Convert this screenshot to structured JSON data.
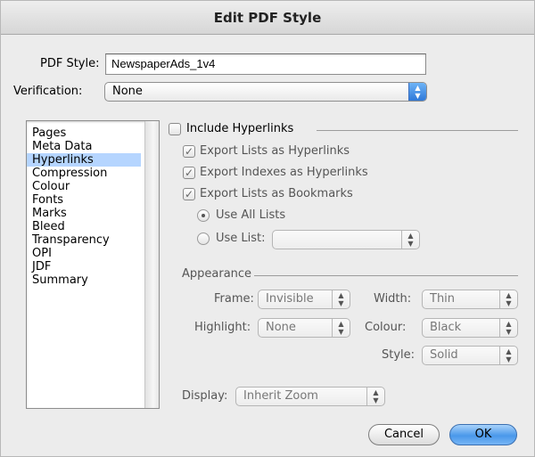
{
  "window": {
    "title": "Edit PDF Style"
  },
  "pdf_style": {
    "label": "PDF Style:",
    "value": "NewspaperAds_1v4"
  },
  "verification": {
    "label": "Verification:",
    "value": "None"
  },
  "sidebar": {
    "items": [
      {
        "label": "Pages"
      },
      {
        "label": "Meta Data"
      },
      {
        "label": "Hyperlinks",
        "selected": true
      },
      {
        "label": "Compression"
      },
      {
        "label": "Colour"
      },
      {
        "label": "Fonts"
      },
      {
        "label": "Marks"
      },
      {
        "label": "Bleed"
      },
      {
        "label": "Transparency"
      },
      {
        "label": "OPI"
      },
      {
        "label": "JDF"
      },
      {
        "label": "Summary"
      }
    ]
  },
  "hyperlinks": {
    "include_label": "Include Hyperlinks",
    "include_checked": false,
    "export_lists_label": "Export Lists as Hyperlinks",
    "export_indexes_label": "Export Indexes as Hyperlinks",
    "export_bookmarks_label": "Export Lists as Bookmarks",
    "use_all_lists_label": "Use All Lists",
    "use_list_label": "Use List:",
    "use_list_value": ""
  },
  "appearance": {
    "group_label": "Appearance",
    "frame_label": "Frame:",
    "frame_value": "Invisible",
    "width_label": "Width:",
    "width_value": "Thin",
    "highlight_label": "Highlight:",
    "highlight_value": "None",
    "colour_label": "Colour:",
    "colour_value": "Black",
    "style_label": "Style:",
    "style_value": "Solid"
  },
  "display": {
    "label": "Display:",
    "value": "Inherit Zoom"
  },
  "buttons": {
    "cancel_label": "Cancel",
    "ok_label": "OK"
  },
  "icons": {
    "check": "✓",
    "popup_arrows": "▲▼"
  }
}
